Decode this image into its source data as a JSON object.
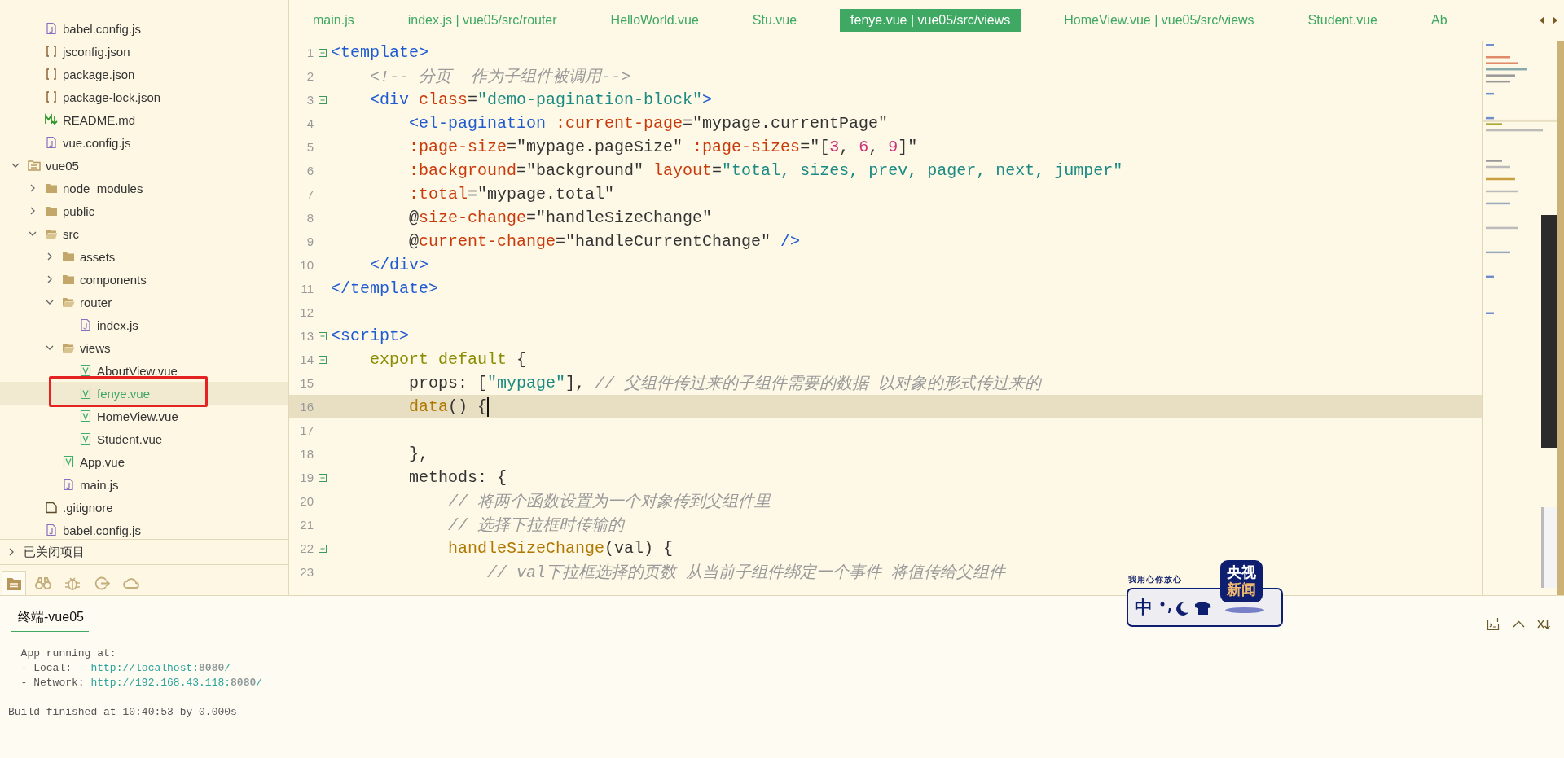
{
  "sidebar": {
    "files_above": [
      {
        "label": "babel.config.js",
        "kind": "js"
      },
      {
        "label": "jsconfig.json",
        "kind": "json"
      },
      {
        "label": "package.json",
        "kind": "json"
      },
      {
        "label": "package-lock.json",
        "kind": "json"
      },
      {
        "label": "README.md",
        "kind": "md"
      },
      {
        "label": "vue.config.js",
        "kind": "js"
      }
    ],
    "tree": [
      {
        "label": "vue05",
        "kind": "project",
        "expanded": true,
        "children": [
          {
            "label": "node_modules",
            "kind": "folder",
            "expanded": false
          },
          {
            "label": "public",
            "kind": "folder",
            "expanded": false
          },
          {
            "label": "src",
            "kind": "folder",
            "expanded": true,
            "children": [
              {
                "label": "assets",
                "kind": "folder",
                "expanded": false
              },
              {
                "label": "components",
                "kind": "folder",
                "expanded": false
              },
              {
                "label": "router",
                "kind": "folder",
                "expanded": true,
                "children": [
                  {
                    "label": "index.js",
                    "kind": "js"
                  }
                ]
              },
              {
                "label": "views",
                "kind": "folder",
                "expanded": true,
                "children": [
                  {
                    "label": "AboutView.vue",
                    "kind": "vue",
                    "selected": false,
                    "annotated": false
                  },
                  {
                    "label": "fenye.vue",
                    "kind": "vue",
                    "selected": true,
                    "annotated": true
                  },
                  {
                    "label": "HomeView.vue",
                    "kind": "vue",
                    "selected": false,
                    "annotated": false
                  },
                  {
                    "label": "Student.vue",
                    "kind": "vue",
                    "selected": false,
                    "annotated": false
                  }
                ]
              },
              {
                "label": "App.vue",
                "kind": "vue"
              },
              {
                "label": "main.js",
                "kind": "js"
              }
            ]
          },
          {
            "label": ".gitignore",
            "kind": "file"
          },
          {
            "label": "babel.config.js",
            "kind": "js"
          }
        ]
      }
    ],
    "closed_projects": {
      "label": "已关闭项目",
      "expanded": false
    },
    "toolbar": [
      {
        "kind": "files",
        "selected": true
      },
      {
        "kind": "binoculars",
        "selected": false
      },
      {
        "kind": "bug",
        "selected": false
      },
      {
        "kind": "run",
        "selected": false
      },
      {
        "kind": "cloud",
        "selected": false
      }
    ]
  },
  "tabs": [
    {
      "label": "main.js",
      "selected": false
    },
    {
      "label": "index.js | vue05/src/router",
      "selected": false
    },
    {
      "label": "HelloWorld.vue",
      "selected": false
    },
    {
      "label": "Stu.vue",
      "selected": false
    },
    {
      "label": "fenye.vue | vue05/src/views",
      "selected": true
    },
    {
      "label": "HomeView.vue | vue05/src/views",
      "selected": false
    },
    {
      "label": "Student.vue",
      "selected": false
    },
    {
      "label": "Ab",
      "selected": false
    }
  ],
  "code": [
    {
      "n": "1",
      "fold": true,
      "current": false,
      "tokens": [
        {
          "kind": "tag",
          "t": "<template>"
        }
      ]
    },
    {
      "n": "2",
      "fold": false,
      "current": false,
      "tokens": [
        {
          "kind": "comment",
          "t": "    <!-- 分页  作为子组件被调用-->"
        }
      ]
    },
    {
      "n": "3",
      "fold": true,
      "current": false,
      "tokens": [
        {
          "kind": "tag",
          "t": "    <div "
        },
        {
          "kind": "attr",
          "t": "class"
        },
        {
          "kind": "plain",
          "t": "="
        },
        {
          "kind": "str",
          "t": "\"demo-pagination-block\""
        },
        {
          "kind": "tag",
          "t": ">"
        }
      ]
    },
    {
      "n": "4",
      "fold": false,
      "current": false,
      "tokens": [
        {
          "kind": "tag",
          "t": "        <el-pagination "
        },
        {
          "kind": "attr",
          "t": ":current-page"
        },
        {
          "kind": "plain",
          "t": "=\"mypage.currentPage\""
        }
      ]
    },
    {
      "n": "5",
      "fold": false,
      "current": false,
      "tokens": [
        {
          "kind": "attr",
          "t": "        :page-size"
        },
        {
          "kind": "plain",
          "t": "=\"mypage.pageSize\" "
        },
        {
          "kind": "attr",
          "t": ":page-sizes"
        },
        {
          "kind": "plain",
          "t": "=\"["
        },
        {
          "kind": "num",
          "t": "3"
        },
        {
          "kind": "plain",
          "t": ", "
        },
        {
          "kind": "num",
          "t": "6"
        },
        {
          "kind": "plain",
          "t": ", "
        },
        {
          "kind": "num",
          "t": "9"
        },
        {
          "kind": "plain",
          "t": "]\""
        }
      ]
    },
    {
      "n": "6",
      "fold": false,
      "current": false,
      "tokens": [
        {
          "kind": "attr",
          "t": "        :background"
        },
        {
          "kind": "plain",
          "t": "=\"background\" "
        },
        {
          "kind": "attr",
          "t": "layout"
        },
        {
          "kind": "plain",
          "t": "="
        },
        {
          "kind": "str",
          "t": "\"total, sizes, prev, pager, next, jumper\""
        }
      ]
    },
    {
      "n": "7",
      "fold": false,
      "current": false,
      "tokens": [
        {
          "kind": "attr",
          "t": "        :total"
        },
        {
          "kind": "plain",
          "t": "=\"mypage.total\""
        }
      ]
    },
    {
      "n": "8",
      "fold": false,
      "current": false,
      "tokens": [
        {
          "kind": "plain",
          "t": "        @"
        },
        {
          "kind": "attr",
          "t": "size-change"
        },
        {
          "kind": "plain",
          "t": "=\"handleSizeChange\""
        }
      ]
    },
    {
      "n": "9",
      "fold": false,
      "current": false,
      "tokens": [
        {
          "kind": "plain",
          "t": "        @"
        },
        {
          "kind": "attr",
          "t": "current-change"
        },
        {
          "kind": "plain",
          "t": "=\"handleCurrentChange\" "
        },
        {
          "kind": "tag",
          "t": "/>"
        }
      ]
    },
    {
      "n": "10",
      "fold": false,
      "current": false,
      "tokens": [
        {
          "kind": "tag",
          "t": "    </div>"
        }
      ]
    },
    {
      "n": "11",
      "fold": false,
      "current": false,
      "tokens": [
        {
          "kind": "tag",
          "t": "</template>"
        }
      ]
    },
    {
      "n": "12",
      "fold": false,
      "current": false
    },
    {
      "n": "13",
      "fold": true,
      "current": false,
      "tokens": [
        {
          "kind": "tag",
          "t": "<script>"
        }
      ]
    },
    {
      "n": "14",
      "fold": true,
      "current": false,
      "tokens": [
        {
          "kind": "kw",
          "t": "    export default "
        },
        {
          "kind": "plain",
          "t": "{"
        }
      ]
    },
    {
      "n": "15",
      "fold": false,
      "current": false,
      "tokens": [
        {
          "kind": "plain",
          "t": "        props: ["
        },
        {
          "kind": "str",
          "t": "\"mypage\""
        },
        {
          "kind": "plain",
          "t": "], "
        },
        {
          "kind": "comment",
          "t": "// 父组件传过来的子组件需要的数据 以对象的形式传过来的"
        }
      ]
    },
    {
      "n": "16",
      "fold": false,
      "current": true,
      "tokens": [
        {
          "kind": "fn",
          "t": "        data"
        },
        {
          "kind": "plain",
          "t": "() {"
        }
      ]
    },
    {
      "n": "17",
      "fold": false,
      "current": false
    },
    {
      "n": "18",
      "fold": false,
      "current": false,
      "tokens": [
        {
          "kind": "plain",
          "t": "        },"
        }
      ]
    },
    {
      "n": "19",
      "fold": true,
      "current": false,
      "tokens": [
        {
          "kind": "plain",
          "t": "        methods: {"
        }
      ]
    },
    {
      "n": "20",
      "fold": false,
      "current": false,
      "tokens": [
        {
          "kind": "comment",
          "t": "            // 将两个函数设置为一个对象传到父组件里"
        }
      ]
    },
    {
      "n": "21",
      "fold": false,
      "current": false,
      "tokens": [
        {
          "kind": "comment",
          "t": "            // 选择下拉框时传输的"
        }
      ]
    },
    {
      "n": "22",
      "fold": true,
      "current": false,
      "tokens": [
        {
          "kind": "fn",
          "t": "            handleSizeChange"
        },
        {
          "kind": "plain",
          "t": "(val) {"
        }
      ]
    },
    {
      "n": "23",
      "fold": false,
      "current": false,
      "tokens": [
        {
          "kind": "comment",
          "t": "                // val下拉框选择的页数 从当前子组件绑定一个事件 将值传给父组件"
        }
      ]
    }
  ],
  "terminal": {
    "tab": {
      "label": "终端-vue05",
      "selected": true
    },
    "lines": [
      {
        "text": "  App running at:"
      },
      {
        "text": "  - Local:   ",
        "link": "http://localhost:**8080**/"
      },
      {
        "text": "  - Network: ",
        "link": "http://192.168.43.118:**8080**/"
      }
    ],
    "build_status": "Build finished at 10:40:53 by 0.000s"
  },
  "news_logo": {
    "tagline": "我用心你放心",
    "mark": "中",
    "badge_top": "央视",
    "badge_bottom": "新闻"
  }
}
